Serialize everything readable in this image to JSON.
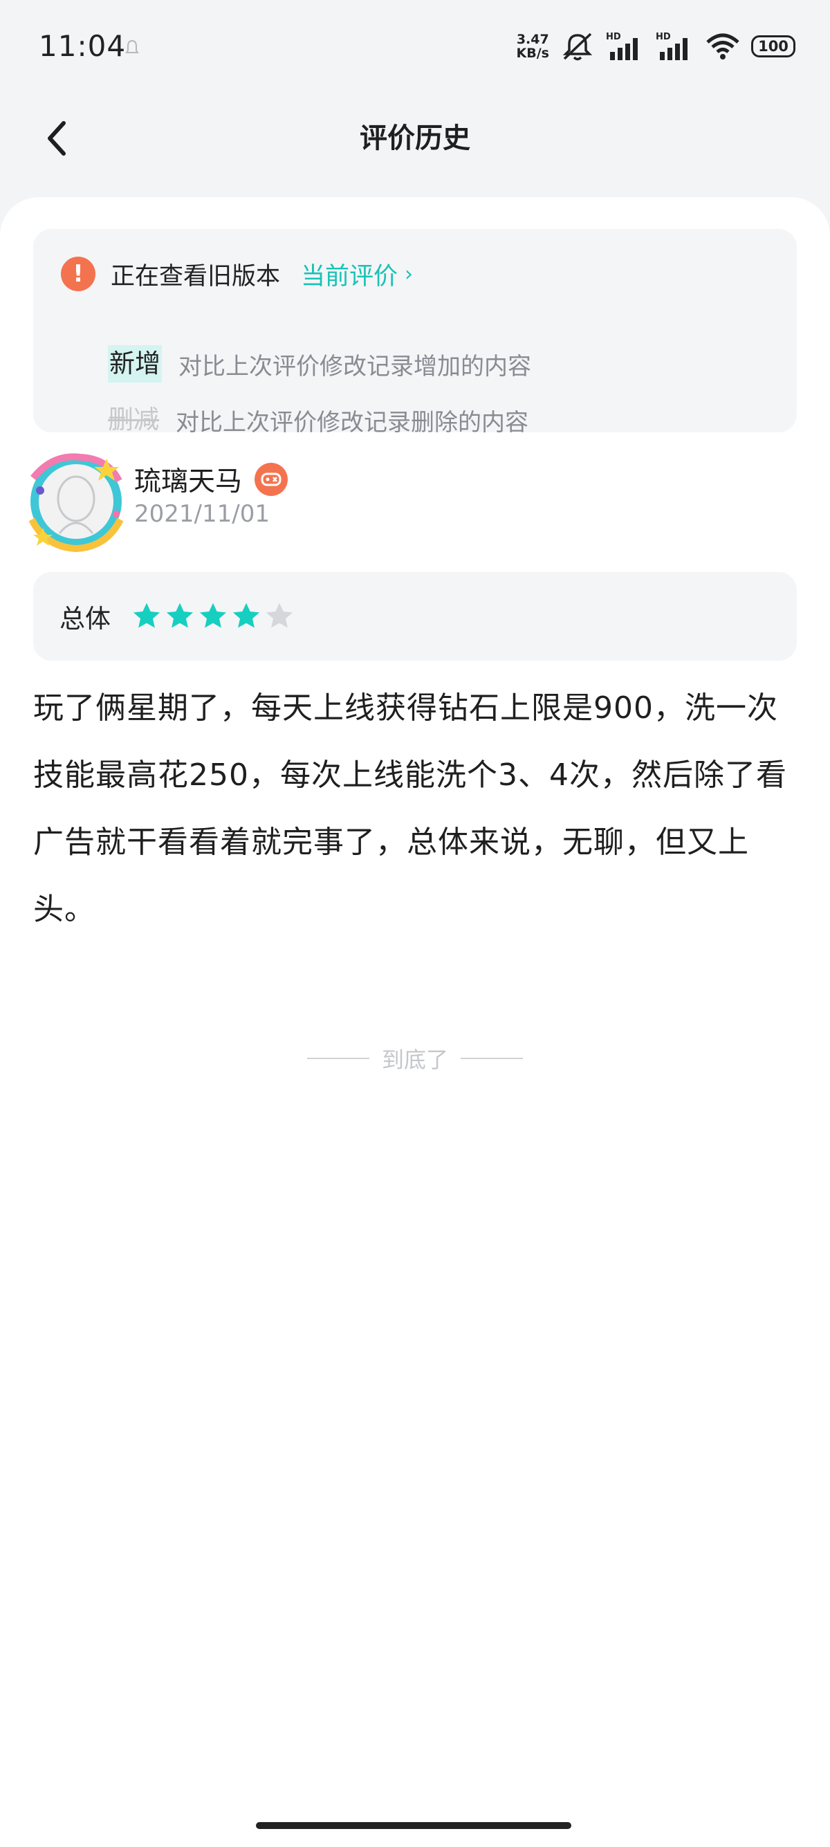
{
  "status_bar": {
    "time": "11:04",
    "net_speed_value": "3.47",
    "net_speed_unit": "KB/s",
    "battery": "100",
    "icons": [
      "notification-bell-icon",
      "mute-icon",
      "signal-hd-icon",
      "signal-hd-icon",
      "wifi-icon",
      "battery-icon"
    ]
  },
  "header": {
    "back_icon": "chevron-left-icon",
    "title": "评价历史"
  },
  "notice": {
    "icon": "warning-icon",
    "text": "正在查看旧版本",
    "current_link": "当前评价",
    "link_chevron": "›",
    "added_tag": "新增",
    "added_desc": "对比上次评价修改记录增加的内容",
    "removed_tag": "删减",
    "removed_desc": "对比上次评价修改记录删除的内容"
  },
  "review": {
    "username": "琉璃天马",
    "badge_icon": "game-controller-badge-icon",
    "date": "2021/11/01",
    "rating_label": "总体",
    "rating": 4,
    "rating_max": 5,
    "body": "玩了俩星期了，每天上线获得钻石上限是900，洗一次技能最高花250，每次上线能洗个3、4次，然后除了看广告就干看看着就完事了，总体来说，无聊，但又上头。"
  },
  "footer": {
    "end_text": "到底了"
  },
  "colors": {
    "accent": "#17c3b6",
    "warning": "#f4734f",
    "star_on": "#17cfc0",
    "star_off": "#d5d7da"
  }
}
